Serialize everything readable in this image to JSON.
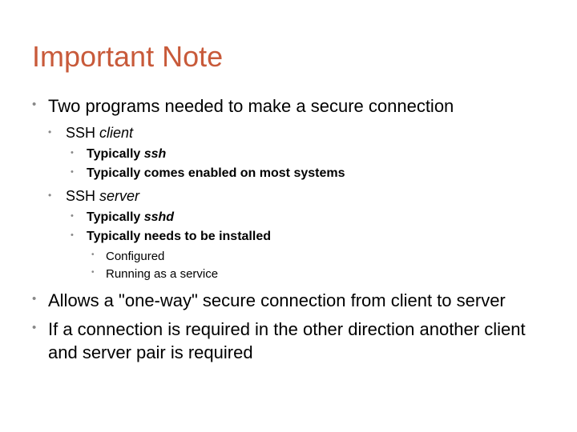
{
  "title": "Important Note",
  "bullets": {
    "l1_0": "Two programs needed to make a secure connection",
    "l2_0_pre": "SSH ",
    "l2_0_em": "client",
    "l3_0_pre": "Typically ",
    "l3_0_em": "ssh",
    "l3_1": "Typically comes enabled on most systems",
    "l2_1_pre": "SSH ",
    "l2_1_em": "server",
    "l3_2_pre": "Typically ",
    "l3_2_em": "sshd",
    "l3_3": "Typically needs to be installed",
    "l4_0": "Configured",
    "l4_1": "Running as a service",
    "l1_1": "Allows a \"one-way\" secure connection from client to server",
    "l1_2": "If a connection is required in the other direction another client and server pair is required"
  }
}
